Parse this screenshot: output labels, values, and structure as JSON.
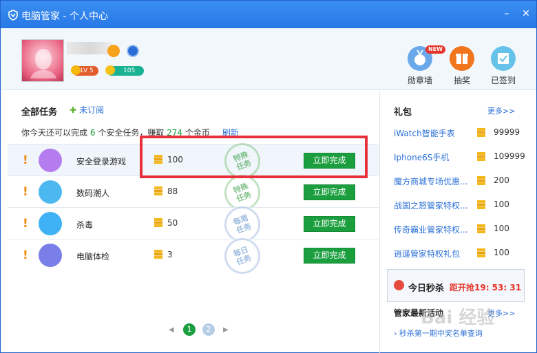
{
  "window": {
    "title": "电脑管家 - 个人中心",
    "minimize": "–",
    "close": "✕"
  },
  "profile": {
    "level": "LV 5",
    "coins": "105"
  },
  "header_buttons": {
    "medals": "勋章墙",
    "lottery": "抽奖",
    "signed": "已签到",
    "new_tag": "NEW"
  },
  "tasks": {
    "heading": "全部任务",
    "unsubscribed": "未订阅",
    "summary_prefix": "你今天还可以完成",
    "summary_count": "6",
    "summary_mid": "个安全任务，赚取",
    "summary_coins": "274",
    "summary_suffix": "个金币",
    "refresh": "刷新",
    "items": [
      {
        "name": "安全登录游戏",
        "coins": "100",
        "stamp": "特殊任务",
        "button": "立即完成",
        "color": "#b57cf0"
      },
      {
        "name": "数码潮人",
        "coins": "88",
        "stamp": "特殊任务",
        "button": "立即完成",
        "color": "#4cb8f0"
      },
      {
        "name": "杀毒",
        "coins": "50",
        "stamp": "每周任务",
        "button": "立即完成",
        "color": "#3fb2f5"
      },
      {
        "name": "电脑体检",
        "coins": "3",
        "stamp": "每日任务",
        "button": "立即完成",
        "color": "#7a7ee8"
      }
    ],
    "mark": "!"
  },
  "pager": {
    "prev": "◀",
    "next": "▶",
    "page1": "1",
    "page2": "2"
  },
  "gifts": {
    "heading": "礼包",
    "more": "更多>>",
    "items": [
      {
        "name": "iWatch智能手表",
        "value": "99999"
      },
      {
        "name": "Iphone6S手机",
        "value": "109999"
      },
      {
        "name": "魔方商城专场优惠...",
        "value": "200"
      },
      {
        "name": "战国之怒管家特权...",
        "value": "100"
      },
      {
        "name": "传奇霸业管家特权...",
        "value": "100"
      },
      {
        "name": "逍遥管家特权礼包",
        "value": "100"
      }
    ]
  },
  "flash_sale": {
    "title": "今日秒杀",
    "timer": "距开抢19: 53: 31"
  },
  "activities": {
    "heading": "管家最新活动",
    "more": "更多>>",
    "item": "› 秒杀第一期中奖名单查询"
  },
  "watermark": "Bai 经验"
}
